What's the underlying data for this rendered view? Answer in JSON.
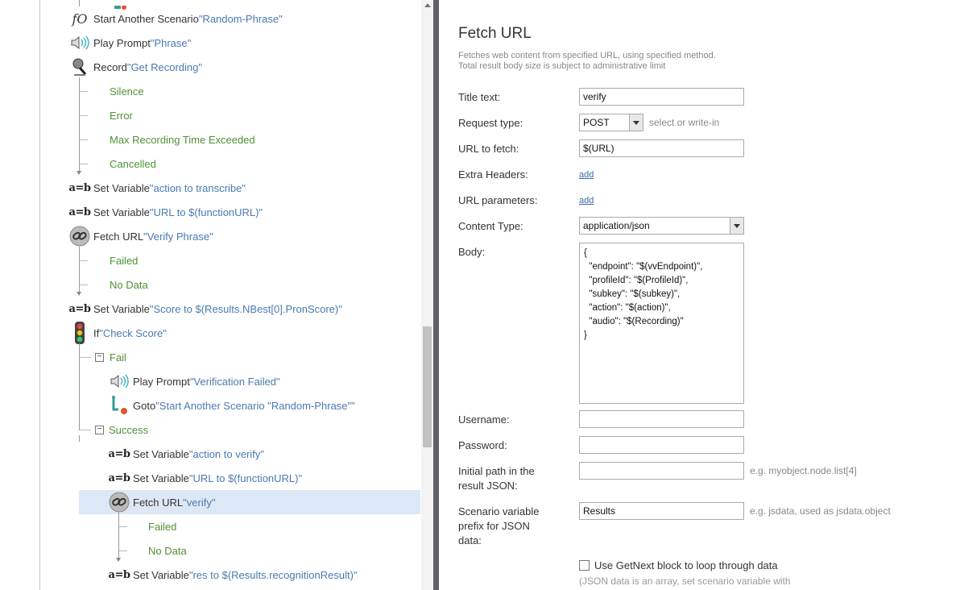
{
  "tree": {
    "rows": [
      {
        "label": "Start Another Scenario ",
        "quoted": "\"Random-Phrase\"",
        "icon": "function-icon"
      },
      {
        "label": "Play Prompt ",
        "quoted": "\"Phrase\"",
        "icon": "speaker-icon"
      },
      {
        "label": "Record ",
        "quoted": "\"Get Recording\"",
        "icon": "microphone-icon"
      },
      {
        "branch": "Silence"
      },
      {
        "branch": "Error"
      },
      {
        "branch": "Max Recording Time Exceeded"
      },
      {
        "branch": "Cancelled"
      },
      {
        "label": "Set Variable ",
        "quoted": "\"action to transcribe\"",
        "icon": "ab-icon"
      },
      {
        "label": "Set Variable ",
        "quoted": "\"URL to $(functionURL)\"",
        "icon": "ab-icon"
      },
      {
        "label": "Fetch URL ",
        "quoted": "\"Verify Phrase\"",
        "icon": "link-icon"
      },
      {
        "branch": "Failed"
      },
      {
        "branch": "No Data"
      },
      {
        "label": "Set Variable ",
        "quoted": "\"Score to $(Results.NBest[0].PronScore)\"",
        "icon": "ab-icon"
      },
      {
        "label": "If ",
        "quoted": "\"Check Score\"",
        "icon": "traffic-light-icon"
      },
      {
        "branch": "Fail"
      },
      {
        "label": "Play Prompt ",
        "quoted": "\"Verification Failed\"",
        "icon": "speaker-icon"
      },
      {
        "label": "Goto ",
        "quoted": "\"Start Another Scenario \"Random-Phrase\"\"",
        "icon": "goto-icon"
      },
      {
        "branch": "Success"
      },
      {
        "label": "Set Variable ",
        "quoted": "\"action to verify\"",
        "icon": "ab-icon"
      },
      {
        "label": "Set Variable ",
        "quoted": "\"URL to $(functionURL)\"",
        "icon": "ab-icon"
      },
      {
        "label": "Fetch URL ",
        "quoted": "\"verify\"",
        "icon": "link-icon"
      },
      {
        "branch": "Failed"
      },
      {
        "branch": "No Data"
      },
      {
        "label": "Set Variable ",
        "quoted": "\"res to $(Results.recognitionResult)\"",
        "icon": "ab-icon"
      }
    ],
    "ab_glyph": "a=b",
    "fo_glyph": "fO",
    "expander_collapse": "−"
  },
  "form": {
    "title": "Fetch URL",
    "desc_line1": "Fetches web content from specified URL, using specified method.",
    "desc_line2": "Total result body size is subject to administrative limit",
    "title_text_label": "Title text:",
    "title_text_value": "verify",
    "request_type_label": "Request type:",
    "request_type_value": "POST",
    "request_type_hint": "select or write-in",
    "url_label": "URL to fetch:",
    "url_value": "$(URL)",
    "extra_headers_label": "Extra Headers:",
    "extra_headers_add": "add",
    "url_params_label": "URL parameters:",
    "url_params_add": "add",
    "content_type_label": "Content Type:",
    "content_type_value": "application/json",
    "body_label": "Body:",
    "body_value": "{\n  \"endpoint\": \"$(vvEndpoint)\",\n  \"profileId\": \"$(ProfileId)\",\n  \"subkey\": \"$(subkey)\",\n  \"action\": \"$(action)\",\n  \"audio\": \"$(Recording)\"\n}",
    "username_label": "Username:",
    "username_value": "",
    "password_label": "Password:",
    "password_value": "",
    "initial_path_label_1": "Initial path in the",
    "initial_path_label_2": "result JSON:",
    "initial_path_value": "",
    "initial_path_hint": "e.g. myobject.node.list[4]",
    "prefix_label_1": "Scenario variable",
    "prefix_label_2": "prefix for JSON",
    "prefix_label_3": "data:",
    "prefix_value": "Results",
    "prefix_hint": "e.g. jsdata, used as jsdata.object",
    "getnext_label": "Use GetNext block to loop through data",
    "getnext_note": "(JSON data is an array, set scenario variable with"
  }
}
